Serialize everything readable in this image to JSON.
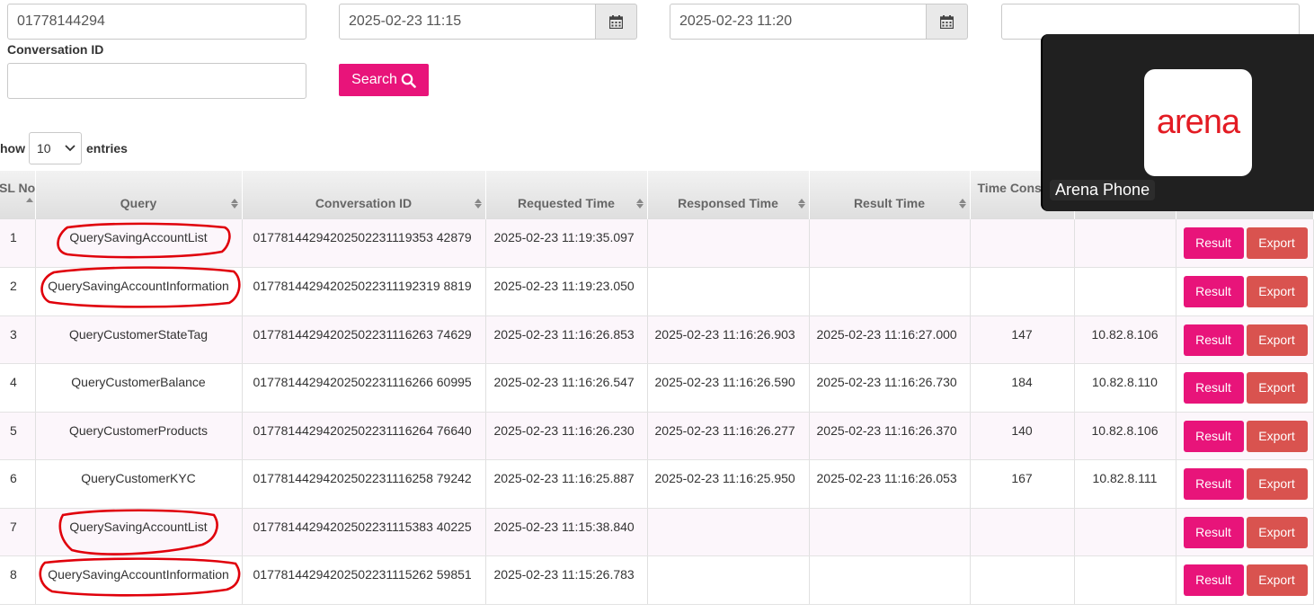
{
  "filters": {
    "msisdn_value": "01778144294",
    "start_time_value": "2025-02-23 11:15",
    "end_time_value": "2025-02-23 11:20",
    "extra_value": "",
    "conversation_id_label": "Conversation ID",
    "conversation_id_value": "",
    "search_label": "Search"
  },
  "length_menu": {
    "prefix": "how",
    "value": "10",
    "suffix": "entries"
  },
  "table": {
    "headers": [
      "SL No",
      "Query",
      "Conversation ID",
      "Requested Time",
      "Responsed Time",
      "Result Time",
      "Time Consu",
      "",
      ""
    ],
    "rows": [
      {
        "sl": "1",
        "query": "QuerySavingAccountList",
        "conv_id": "01778144294202502231119353 42879",
        "req": "2025-02-23 11:19:35.097",
        "resp": "",
        "result": "",
        "time": "",
        "ip": ""
      },
      {
        "sl": "2",
        "query": "QuerySavingAccountInformation",
        "conv_id": "017781442942025022311192319 8819",
        "req": "2025-02-23 11:19:23.050",
        "resp": "",
        "result": "",
        "time": "",
        "ip": ""
      },
      {
        "sl": "3",
        "query": "QueryCustomerStateTag",
        "conv_id": "01778144294202502231116263 74629",
        "req": "2025-02-23 11:16:26.853",
        "resp": "2025-02-23 11:16:26.903",
        "result": "2025-02-23 11:16:27.000",
        "time": "147",
        "ip": "10.82.8.106"
      },
      {
        "sl": "4",
        "query": "QueryCustomerBalance",
        "conv_id": "01778144294202502231116266 60995",
        "req": "2025-02-23 11:16:26.547",
        "resp": "2025-02-23 11:16:26.590",
        "result": "2025-02-23 11:16:26.730",
        "time": "184",
        "ip": "10.82.8.110"
      },
      {
        "sl": "5",
        "query": "QueryCustomerProducts",
        "conv_id": "01778144294202502231116264 76640",
        "req": "2025-02-23 11:16:26.230",
        "resp": "2025-02-23 11:16:26.277",
        "result": "2025-02-23 11:16:26.370",
        "time": "140",
        "ip": "10.82.8.106"
      },
      {
        "sl": "6",
        "query": "QueryCustomerKYC",
        "conv_id": "01778144294202502231116258 79242",
        "req": "2025-02-23 11:16:25.887",
        "resp": "2025-02-23 11:16:25.950",
        "result": "2025-02-23 11:16:26.053",
        "time": "167",
        "ip": "10.82.8.111"
      },
      {
        "sl": "7",
        "query": "QuerySavingAccountList",
        "conv_id": "01778144294202502231115383 40225",
        "req": "2025-02-23 11:15:38.840",
        "resp": "",
        "result": "",
        "time": "",
        "ip": ""
      },
      {
        "sl": "8",
        "query": "QuerySavingAccountInformation",
        "conv_id": "01778144294202502231115262 59851",
        "req": "2025-02-23 11:15:26.783",
        "resp": "",
        "result": "",
        "time": "",
        "ip": ""
      }
    ],
    "result_label": "Result",
    "export_label": "Export"
  },
  "overlay": {
    "logo_text": "arena",
    "label": "Arena Phone"
  },
  "icons": [
    "calendar-icon",
    "search-icon",
    "chevron-down-icon",
    "sort-icon"
  ],
  "colors": {
    "accent": "#e8147a",
    "export": "#d9534f",
    "annotation": "#e0000b",
    "arena_red": "#e31b23"
  }
}
